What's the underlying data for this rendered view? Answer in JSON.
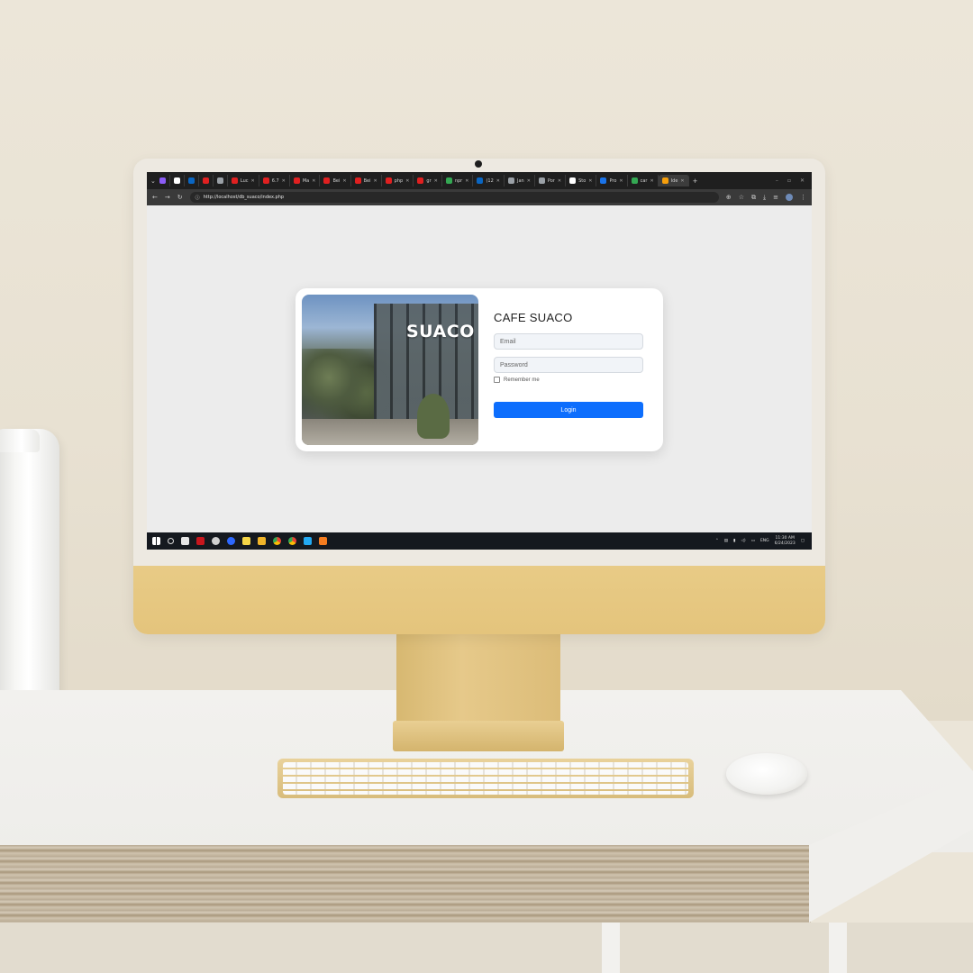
{
  "browser": {
    "tabs": [
      {
        "label": "",
        "color": "#8b5cf6"
      },
      {
        "label": "",
        "color": "#ffffff"
      },
      {
        "label": "",
        "color": "#0a66c2"
      },
      {
        "label": "",
        "color": "#e02020"
      },
      {
        "label": "",
        "color": "#9aa0a6"
      },
      {
        "label": "Luc",
        "color": "#e02020"
      },
      {
        "label": "6.7",
        "color": "#e02020"
      },
      {
        "label": "Ma",
        "color": "#e02020"
      },
      {
        "label": "Bei",
        "color": "#e02020"
      },
      {
        "label": "Bei",
        "color": "#e02020"
      },
      {
        "label": "php",
        "color": "#e02020"
      },
      {
        "label": "gr",
        "color": "#e02020"
      },
      {
        "label": "npr",
        "color": "#34a853"
      },
      {
        "label": "(12",
        "color": "#0a66c2"
      },
      {
        "label": "Jan",
        "color": "#9aa0a6"
      },
      {
        "label": "Por",
        "color": "#9aa0a6"
      },
      {
        "label": "Sto",
        "color": "#ffffff"
      },
      {
        "label": "Pro",
        "color": "#1a73e8"
      },
      {
        "label": "car",
        "color": "#34a853"
      },
      {
        "label": "Ide",
        "color": "#f59e0b"
      }
    ],
    "address": "http://localhost/db_suaco/index.php"
  },
  "login": {
    "photo_sign": "SUACO",
    "title": "CAFE SUACO",
    "email_placeholder": "Email",
    "password_placeholder": "Password",
    "remember_label": "Remember me",
    "login_label": "Login"
  },
  "taskbar": {
    "lang": "ENG",
    "time": "11:30 AM",
    "date": "6/24/2023"
  },
  "colors": {
    "accent": "#0d6efd",
    "page_bg": "#ececec"
  }
}
